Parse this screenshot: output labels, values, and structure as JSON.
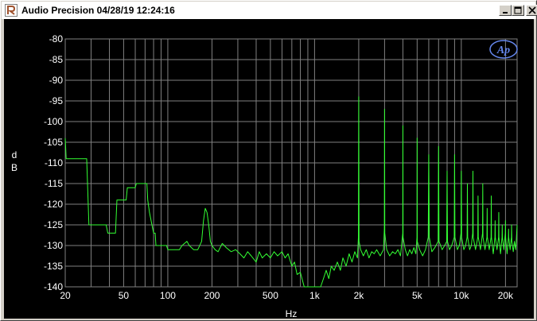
{
  "window": {
    "title": "Audio Precision  04/28/19 12:24:16",
    "icon": "audio-precision-app-icon",
    "buttons": {
      "minimize": "minimize-icon",
      "maximize": "maximize-icon",
      "close": "close-icon"
    }
  },
  "logo": {
    "text": "Ap"
  },
  "colors": {
    "background": "#000000",
    "grid": "#808080",
    "trace": "#33ff33",
    "text": "#ffffff",
    "logo": "#6688ee"
  },
  "chart_data": {
    "type": "line",
    "xlabel": "Hz",
    "ylabel": "dB",
    "ylabel_chars": [
      "d",
      "B"
    ],
    "xscale": "log",
    "xlim": [
      20,
      24000
    ],
    "ylim": [
      -140,
      -80
    ],
    "yticks": [
      -80,
      -85,
      -90,
      -95,
      -100,
      -105,
      -110,
      -115,
      -120,
      -125,
      -130,
      -135,
      -140
    ],
    "ytick_labels": [
      "-80",
      "-85",
      "-90",
      "-95",
      "-100",
      "-105",
      "-110",
      "-115",
      "-120",
      "-125",
      "-130",
      "-135",
      "-140"
    ],
    "xticks": [
      20,
      50,
      100,
      200,
      500,
      1000,
      2000,
      5000,
      10000,
      20000
    ],
    "xtick_labels": [
      "20",
      "50",
      "100",
      "200",
      "500",
      "1k",
      "2k",
      "5k",
      "10k",
      "20k"
    ],
    "grid": true,
    "series": [
      {
        "color": "#33ff33",
        "points": [
          [
            20,
            -104
          ],
          [
            20.3,
            -109
          ],
          [
            28,
            -109
          ],
          [
            29,
            -125
          ],
          [
            30,
            -125
          ],
          [
            35,
            -125
          ],
          [
            38,
            -125
          ],
          [
            39,
            -127
          ],
          [
            44,
            -127
          ],
          [
            45,
            -119
          ],
          [
            52,
            -119
          ],
          [
            53,
            -116
          ],
          [
            60,
            -116
          ],
          [
            61,
            -115
          ],
          [
            72,
            -115
          ],
          [
            73,
            -119
          ],
          [
            75,
            -122
          ],
          [
            80,
            -127
          ],
          [
            82,
            -127
          ],
          [
            83,
            -130
          ],
          [
            98,
            -130
          ],
          [
            100,
            -131
          ],
          [
            120,
            -131
          ],
          [
            125,
            -130
          ],
          [
            135,
            -129
          ],
          [
            140,
            -130
          ],
          [
            150,
            -131
          ],
          [
            160,
            -131
          ],
          [
            170,
            -129
          ],
          [
            175,
            -124
          ],
          [
            180,
            -121
          ],
          [
            185,
            -122
          ],
          [
            190,
            -125
          ],
          [
            195,
            -129
          ],
          [
            200,
            -130
          ],
          [
            210,
            -131
          ],
          [
            220,
            -131.5
          ],
          [
            235,
            -129.5
          ],
          [
            250,
            -130.5
          ],
          [
            270,
            -131.5
          ],
          [
            290,
            -131
          ],
          [
            310,
            -132
          ],
          [
            330,
            -133
          ],
          [
            350,
            -131.5
          ],
          [
            370,
            -132.5
          ],
          [
            400,
            -134
          ],
          [
            420,
            -131.5
          ],
          [
            440,
            -133
          ],
          [
            470,
            -132
          ],
          [
            500,
            -133
          ],
          [
            530,
            -131.5
          ],
          [
            560,
            -132.5
          ],
          [
            600,
            -131.5
          ],
          [
            630,
            -133
          ],
          [
            660,
            -132
          ],
          [
            700,
            -135
          ],
          [
            730,
            -134
          ],
          [
            760,
            -137
          ],
          [
            800,
            -136.5
          ],
          [
            850,
            -140
          ],
          [
            900,
            -140
          ],
          [
            950,
            -140
          ],
          [
            1000,
            -140
          ],
          [
            1050,
            -140
          ],
          [
            1100,
            -140
          ],
          [
            1150,
            -138
          ],
          [
            1200,
            -136
          ],
          [
            1250,
            -138
          ],
          [
            1300,
            -135
          ],
          [
            1360,
            -136
          ],
          [
            1430,
            -134
          ],
          [
            1500,
            -136
          ],
          [
            1560,
            -133
          ],
          [
            1640,
            -135
          ],
          [
            1720,
            -132
          ],
          [
            1800,
            -134
          ],
          [
            1880,
            -131.5
          ],
          [
            1960,
            -133
          ],
          [
            1990,
            -128
          ],
          [
            2000,
            -94
          ],
          [
            2010,
            -129
          ],
          [
            2060,
            -131
          ],
          [
            2150,
            -132.5
          ],
          [
            2250,
            -131
          ],
          [
            2350,
            -133
          ],
          [
            2450,
            -131.5
          ],
          [
            2550,
            -132
          ],
          [
            2650,
            -131
          ],
          [
            2800,
            -132.5
          ],
          [
            2950,
            -131
          ],
          [
            2990,
            -126
          ],
          [
            3000,
            -97
          ],
          [
            3010,
            -127
          ],
          [
            3100,
            -131
          ],
          [
            3250,
            -132.5
          ],
          [
            3400,
            -131.5
          ],
          [
            3550,
            -132
          ],
          [
            3700,
            -131
          ],
          [
            3850,
            -132.5
          ],
          [
            3990,
            -127
          ],
          [
            4000,
            -101
          ],
          [
            4010,
            -128
          ],
          [
            4150,
            -131
          ],
          [
            4300,
            -132.5
          ],
          [
            4450,
            -131
          ],
          [
            4600,
            -132
          ],
          [
            4750,
            -130.5
          ],
          [
            4900,
            -132
          ],
          [
            4990,
            -128
          ],
          [
            5000,
            -104
          ],
          [
            5010,
            -129
          ],
          [
            5200,
            -131
          ],
          [
            5450,
            -132.5
          ],
          [
            5700,
            -131
          ],
          [
            5950,
            -128
          ],
          [
            6000,
            -108
          ],
          [
            6050,
            -128
          ],
          [
            6300,
            -131.5
          ],
          [
            6600,
            -130.5
          ],
          [
            6950,
            -129
          ],
          [
            7000,
            -106
          ],
          [
            7050,
            -129
          ],
          [
            7400,
            -131
          ],
          [
            7700,
            -130
          ],
          [
            7950,
            -129
          ],
          [
            8000,
            -112
          ],
          [
            8050,
            -129
          ],
          [
            8300,
            -131
          ],
          [
            8600,
            -130
          ],
          [
            8950,
            -128
          ],
          [
            9000,
            -108
          ],
          [
            9050,
            -128
          ],
          [
            9400,
            -131
          ],
          [
            9700,
            -130
          ],
          [
            9950,
            -127
          ],
          [
            10000,
            -112
          ],
          [
            10050,
            -128
          ],
          [
            10400,
            -131
          ],
          [
            10700,
            -130
          ],
          [
            10950,
            -128
          ],
          [
            11000,
            -115
          ],
          [
            11050,
            -128
          ],
          [
            11400,
            -131
          ],
          [
            11700,
            -130
          ],
          [
            11950,
            -127
          ],
          [
            12000,
            -112
          ],
          [
            12050,
            -128
          ],
          [
            12500,
            -131
          ],
          [
            12950,
            -128
          ],
          [
            13000,
            -118
          ],
          [
            13050,
            -128
          ],
          [
            13500,
            -131
          ],
          [
            13950,
            -127
          ],
          [
            14000,
            -115
          ],
          [
            14050,
            -128
          ],
          [
            14500,
            -131
          ],
          [
            14950,
            -128
          ],
          [
            15000,
            -121
          ],
          [
            15050,
            -128
          ],
          [
            15500,
            -131
          ],
          [
            15950,
            -128
          ],
          [
            16000,
            -118
          ],
          [
            16050,
            -128
          ],
          [
            16500,
            -132
          ],
          [
            16950,
            -128
          ],
          [
            17000,
            -124
          ],
          [
            17050,
            -128
          ],
          [
            17500,
            -131
          ],
          [
            17950,
            -128
          ],
          [
            18000,
            -122
          ],
          [
            18050,
            -128
          ],
          [
            18500,
            -132
          ],
          [
            18950,
            -128
          ],
          [
            19000,
            -125
          ],
          [
            19050,
            -128
          ],
          [
            19500,
            -131
          ],
          [
            19950,
            -127
          ],
          [
            20000,
            -124
          ],
          [
            20050,
            -128
          ],
          [
            20500,
            -132
          ],
          [
            20950,
            -128
          ],
          [
            21000,
            -126
          ],
          [
            21050,
            -128
          ],
          [
            21500,
            -131
          ],
          [
            21950,
            -128
          ],
          [
            22000,
            -125
          ],
          [
            22100,
            -129
          ],
          [
            22600,
            -131.5
          ],
          [
            23000,
            -129
          ],
          [
            23500,
            -131
          ],
          [
            24000,
            -125
          ]
        ]
      }
    ]
  }
}
